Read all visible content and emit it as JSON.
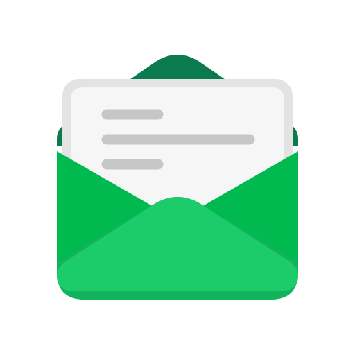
{
  "icon": {
    "name": "open-envelope-icon",
    "colors": {
      "background": "#ffffff",
      "envelope_back_flap": "#0b7a4e",
      "envelope_side_panel": "#00b94f",
      "envelope_front": "#1ccb6a",
      "envelope_front_shadow": "#12b35c",
      "letter_paper": "#f6f6f6",
      "letter_border": "#e3e3e3",
      "letter_lines": "#c6c6c6"
    },
    "letter": {
      "text_line_count": 3
    }
  }
}
